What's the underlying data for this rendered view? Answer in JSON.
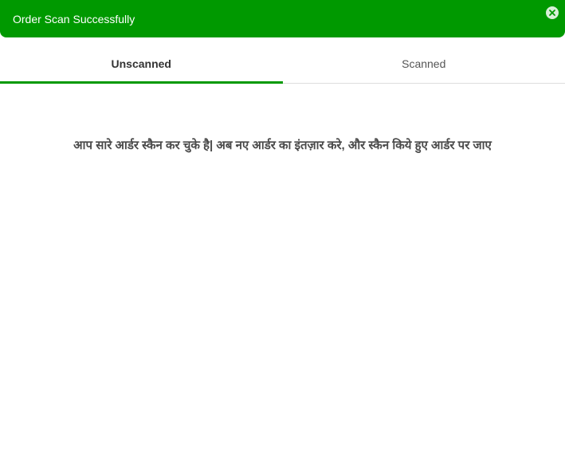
{
  "toast": {
    "message": "Order Scan Successfully",
    "close_icon": "close-circle-icon",
    "background_color": "#009900"
  },
  "tabs": [
    {
      "label": "Unscanned",
      "active": true
    },
    {
      "label": "Scanned",
      "active": false
    }
  ],
  "accent_color": "#009900",
  "empty_state": {
    "message": "आप सारे आर्डर स्कैन कर चुके है| अब नए आर्डर का इंतज़ार करे, और स्कैन किये हुए आर्डर पर जाए"
  }
}
